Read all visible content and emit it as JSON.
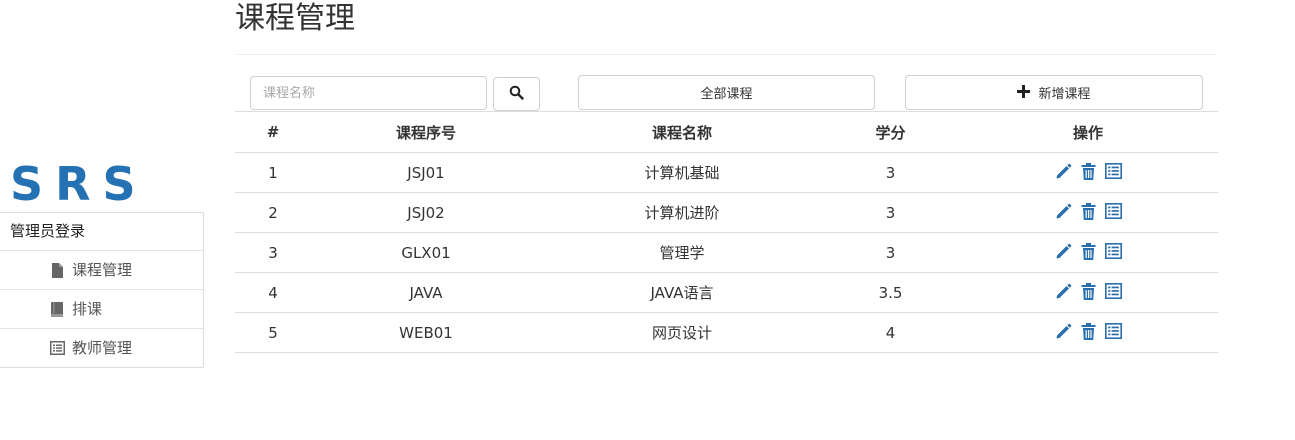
{
  "logo": {
    "text": "SRS"
  },
  "sidebar": {
    "header": "管理员登录",
    "items": [
      {
        "label": "课程管理",
        "icon": "file-icon"
      },
      {
        "label": "排课",
        "icon": "book-icon"
      },
      {
        "label": "教师管理",
        "icon": "list-icon"
      }
    ]
  },
  "main": {
    "title": "课程管理",
    "search": {
      "placeholder": "课程名称",
      "value": ""
    },
    "buttons": {
      "all_courses": "全部课程",
      "add_course": "新增课程"
    },
    "table": {
      "headers": [
        "#",
        "课程序号",
        "课程名称",
        "学分",
        "操作"
      ],
      "rows": [
        {
          "num": "1",
          "id": "JSJ01",
          "name": "计算机基础",
          "credit": "3"
        },
        {
          "num": "2",
          "id": "JSJ02",
          "name": "计算机进阶",
          "credit": "3"
        },
        {
          "num": "3",
          "id": "GLX01",
          "name": "管理学",
          "credit": "3"
        },
        {
          "num": "4",
          "id": "JAVA",
          "name": "JAVA语言",
          "credit": "3.5"
        },
        {
          "num": "5",
          "id": "WEB01",
          "name": "网页设计",
          "credit": "4"
        }
      ],
      "row_actions": [
        "edit-icon",
        "trash-icon",
        "details-icon"
      ]
    }
  },
  "colors": {
    "brand": "#2471b3",
    "action_icon": "#2a6fad"
  }
}
